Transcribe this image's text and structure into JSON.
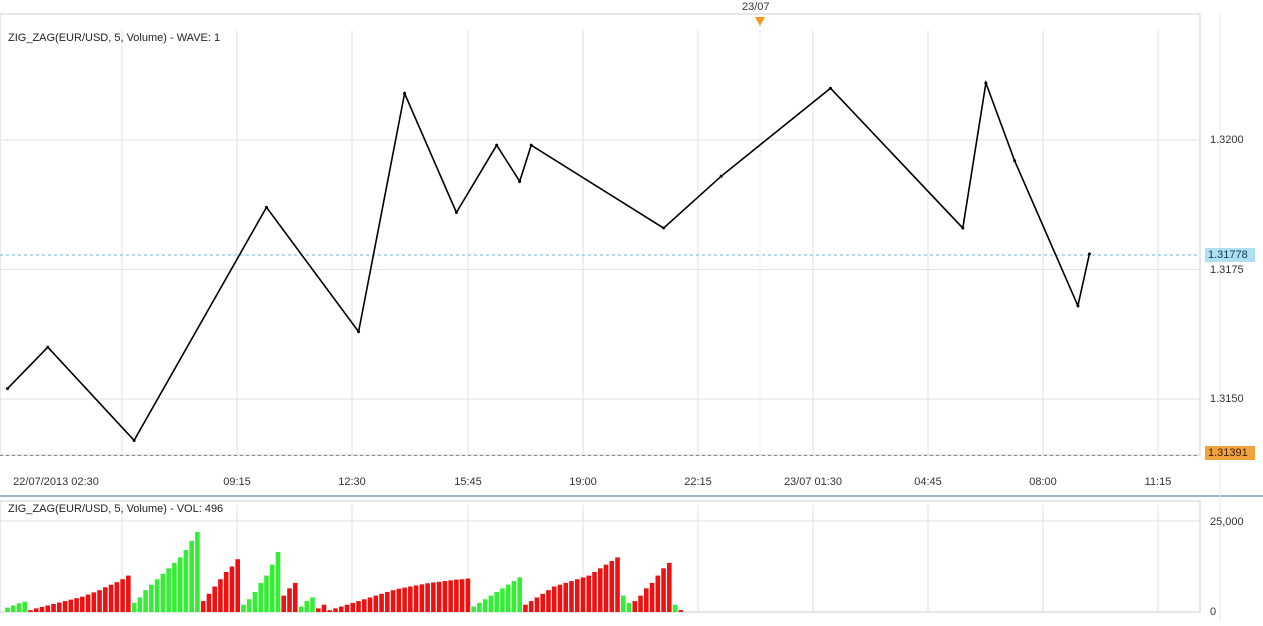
{
  "price_panel": {
    "title": "ZIG_ZAG(EUR/USD, 5, Volume) -  WAVE: 1",
    "date_marker": "23/07",
    "current_price": "1.31778",
    "low_marker": "1.31391",
    "y_ticks": [
      "1.3200",
      "1.3175",
      "1.3150"
    ],
    "x_ticks": [
      "22/07/2013 02:30",
      "09:15",
      "12:30",
      "15:45",
      "19:00",
      "22:15",
      "23/07 01:30",
      "04:45",
      "08:00",
      "11:15"
    ]
  },
  "volume_panel": {
    "title": "ZIG_ZAG(EUR/USD, 5, Volume) -  VOL: 496",
    "y_ticks": [
      "25,000",
      "0"
    ]
  },
  "colors": {
    "up": "#1f5fbf",
    "down": "#dd1111",
    "vol_up": "#33ee33",
    "vol_down": "#ee1111",
    "zigzag": "#000000",
    "grid": "#dde3ea",
    "current_badge": "#aee0f2",
    "low_badge": "#f2a23a"
  },
  "chart_data": [
    {
      "type": "line",
      "name": "zigzag",
      "y_ticks": [
        1.315,
        1.3175,
        1.32
      ],
      "x_index": [
        0,
        7,
        22,
        45,
        61,
        69,
        78,
        85,
        89,
        91,
        114,
        124,
        143,
        166,
        170,
        175,
        186,
        188
      ],
      "y": [
        1.3152,
        1.316,
        1.3142,
        1.3187,
        1.3163,
        1.3209,
        1.3186,
        1.3199,
        1.3192,
        1.3199,
        1.3183,
        1.3193,
        1.321,
        1.3183,
        1.3211,
        1.3196,
        1.3168,
        1.3178
      ]
    },
    {
      "type": "bar",
      "name": "volume",
      "ylim": [
        0,
        25000
      ],
      "groups": [
        {
          "direction": "up",
          "values": [
            1200,
            1800,
            2400,
            2800
          ]
        },
        {
          "direction": "down",
          "values": [
            500,
            1000,
            1400,
            1800,
            2200,
            2600,
            3000,
            3400,
            3800,
            4200,
            4800,
            5400,
            6000,
            6800,
            7500,
            8200,
            9000,
            10000
          ]
        },
        {
          "direction": "up",
          "values": [
            2500,
            4000,
            6000,
            7500,
            9000,
            10500,
            12000,
            13500,
            15000,
            17000,
            19500,
            22000
          ]
        },
        {
          "direction": "down",
          "values": [
            3000,
            5000,
            7000,
            9000,
            11000,
            12500,
            14500
          ]
        },
        {
          "direction": "up",
          "values": [
            2000,
            3500,
            5500,
            8000,
            10000,
            13000,
            16500
          ]
        },
        {
          "direction": "down",
          "values": [
            4500,
            6500,
            8000
          ]
        },
        {
          "direction": "up",
          "values": [
            1500,
            3000,
            4000
          ]
        },
        {
          "direction": "down",
          "values": [
            1000,
            2000,
            500
          ]
        },
        {
          "direction": "down",
          "values": [
            1000,
            1500,
            2000,
            2500,
            3000,
            3500,
            4000,
            4500,
            5000,
            5500,
            6000,
            6400,
            6700,
            7000,
            7300,
            7600,
            7900,
            8100,
            8300,
            8500,
            8700,
            8900,
            9000,
            9200
          ]
        },
        {
          "direction": "up",
          "values": [
            1500,
            2500,
            3500,
            4500,
            5500,
            6500,
            7500,
            8500,
            9500
          ]
        },
        {
          "direction": "down",
          "values": [
            2000,
            3000,
            4000,
            5000,
            6000,
            7000,
            7500,
            8000,
            8500,
            9000,
            9500,
            10000,
            11000,
            12000,
            13000,
            14000,
            15000
          ]
        },
        {
          "direction": "up",
          "values": [
            4500,
            2500
          ]
        },
        {
          "direction": "down",
          "values": [
            3000,
            4500,
            6500,
            8000,
            10000,
            12000,
            13500
          ]
        },
        {
          "direction": "up",
          "values": [
            2000
          ]
        },
        {
          "direction": "down",
          "values": [
            500
          ]
        }
      ]
    }
  ]
}
